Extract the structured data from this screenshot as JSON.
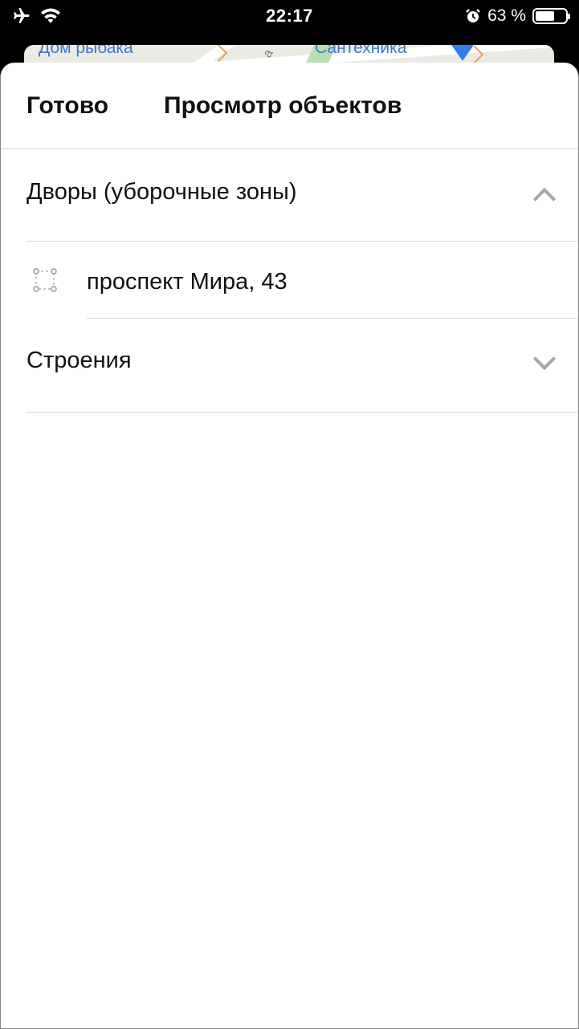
{
  "status_bar": {
    "time": "22:17",
    "battery_percent_text": "63 %",
    "battery_level": 0.63,
    "icons": [
      "airplane-icon",
      "wifi-icon",
      "alarm-icon",
      "battery-icon"
    ]
  },
  "map": {
    "labels": [
      "Дом рыбака",
      "Сантехника"
    ],
    "street_fragment": "а",
    "colors": {
      "road": "#ffffff",
      "park": "#b9dfb0",
      "label": "#3b78d1",
      "pin": "#2f80ed"
    }
  },
  "sheet": {
    "done_label": "Готово",
    "title": "Просмотр объектов",
    "sections": [
      {
        "label": "Дворы (уборочные зоны)",
        "expanded": true,
        "items": [
          {
            "label": "проспект Мира, 43",
            "icon": "polygon-zone-icon"
          }
        ]
      },
      {
        "label": "Строения",
        "expanded": false,
        "items": []
      }
    ]
  }
}
